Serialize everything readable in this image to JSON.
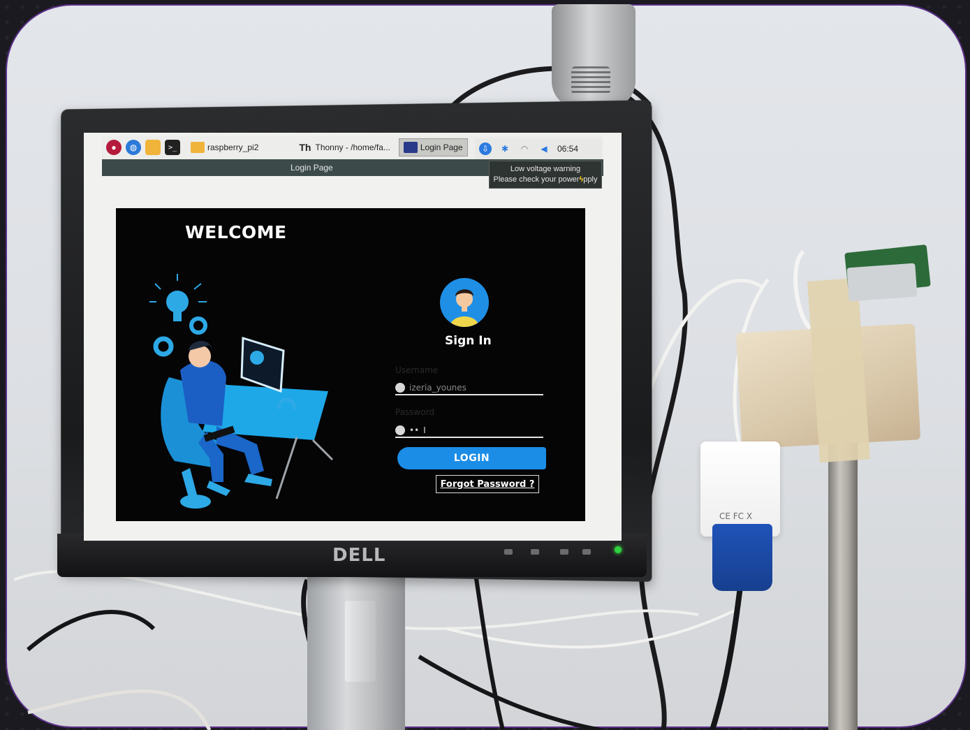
{
  "taskbar": {
    "tasks": [
      {
        "label": "raspberry_pi2"
      },
      {
        "label": "Thonny  -  /home/fa..."
      },
      {
        "label": "Login Page"
      }
    ],
    "thonny_glyph": "Th",
    "clock": "06:54"
  },
  "window": {
    "title": "Login Page"
  },
  "notification": {
    "line1": "Low voltage warning",
    "line2_prefix": "Please check your power",
    "line2_suffix": "pply"
  },
  "login": {
    "welcome": "WELCOME",
    "sign_in": "Sign In",
    "username_label": "Username",
    "username_value": "izeria_younes",
    "password_label": "Password",
    "password_value": "••",
    "login_button": "LOGIN",
    "forgot_link": "Forgot Password ?"
  },
  "hardware": {
    "monitor_brand": "DELL",
    "adapter_marks": "CE FC X"
  },
  "colors": {
    "accent": "#1b8de6",
    "canvas_bg": "#050506",
    "titlebar": "#3c4b4a",
    "power_led": "#2ed13f"
  },
  "icons": [
    "raspberry-icon",
    "globe-icon",
    "folder-icon",
    "terminal-icon",
    "update-icon",
    "bluetooth-icon",
    "wifi-icon",
    "volume-icon",
    "user-icon",
    "lock-icon",
    "lightning-icon"
  ]
}
